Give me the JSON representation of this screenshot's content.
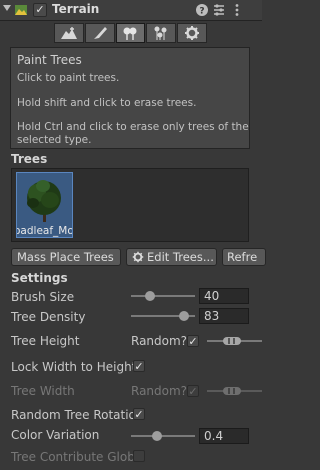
{
  "header": {
    "title": "Terrain"
  },
  "toolbar": {
    "tools": [
      "raise-terrain",
      "paint-texture",
      "paint-trees",
      "paint-details",
      "terrain-settings"
    ],
    "selected": "paint-trees"
  },
  "help": {
    "title": "Paint Trees",
    "lines": [
      "Click to paint trees.",
      "Hold shift and click to erase trees.",
      "Hold Ctrl and click to erase only trees of the",
      "selected type."
    ]
  },
  "trees": {
    "label": "Trees",
    "items": [
      {
        "name": "oadleaf_Mot"
      }
    ]
  },
  "buttons": {
    "mass_place": "Mass Place Trees",
    "edit_trees": "Edit Trees...",
    "refresh": "Refre"
  },
  "settings": {
    "label": "Settings",
    "brush_size": {
      "label": "Brush Size",
      "value": "40",
      "slider": 0.3
    },
    "tree_density": {
      "label": "Tree Density",
      "value": "83",
      "slider": 0.83
    },
    "tree_height": {
      "label": "Tree Height",
      "random_label": "Random?",
      "random": true
    },
    "lock_width": {
      "label": "Lock Width to Height",
      "checked": true
    },
    "tree_width": {
      "label": "Tree Width",
      "random_label": "Random?",
      "random": true,
      "disabled": true
    },
    "random_rotation": {
      "label": "Random Tree Rotatio",
      "checked": true
    },
    "color_variation": {
      "label": "Color Variation",
      "value": "0.4",
      "slider": 0.4
    },
    "contribute_gi": {
      "label": "Tree Contribute Glob",
      "checked": false,
      "disabled": true
    }
  },
  "colors": {
    "background": "#383838",
    "selection": "#3a5a82"
  }
}
